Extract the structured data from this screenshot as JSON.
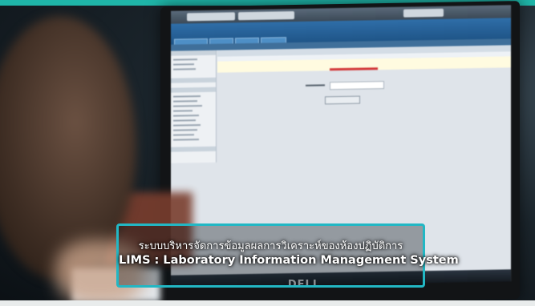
{
  "caption": {
    "line1": "ระบบบริหารจัดการข้อมูลผลการวิเคราะห์ของห้องปฏิบัติการ",
    "line2": "LIMS : Laboratory Information Management System"
  },
  "monitor": {
    "brand_logo": "DELL"
  },
  "colors": {
    "accent_teal": "#1fb5a8",
    "caption_frame": "#22b7c4",
    "app_header_blue": "#1f5588"
  }
}
